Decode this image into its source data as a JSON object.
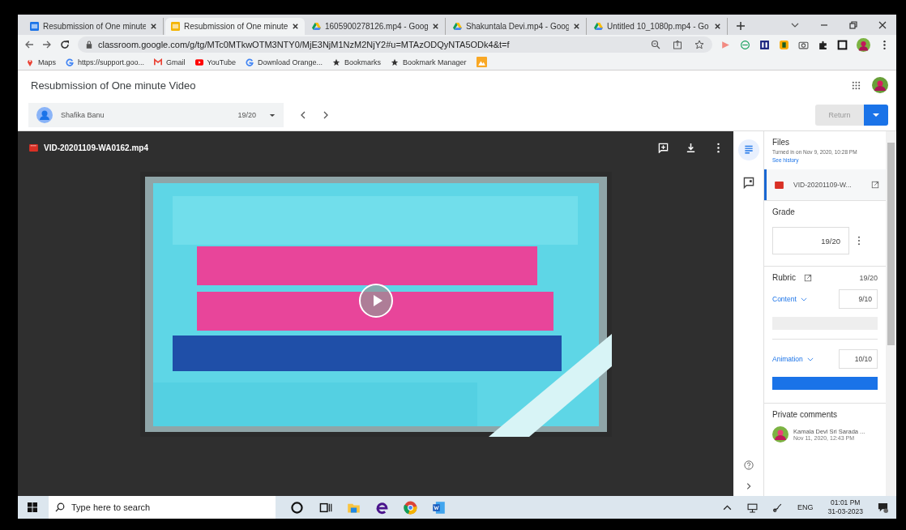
{
  "browser": {
    "tabs": [
      {
        "label": "Resubmission of One minute",
        "kind": "classroom",
        "selected": false
      },
      {
        "label": "Resubmission of One minute",
        "kind": "classroom",
        "selected": true
      },
      {
        "label": "1605900278126.mp4 - Goog",
        "kind": "drive",
        "selected": false
      },
      {
        "label": "Shakuntala Devi.mp4 - Goog",
        "kind": "drive",
        "selected": false
      },
      {
        "label": "Untitled 10_1080p.mp4 - Go",
        "kind": "drive",
        "selected": false
      }
    ],
    "address": "classroom.google.com/g/tg/MTc0MTkwOTM3NTY0/MjE3NjM1NzM2NjY2#u=MTAzODQyNTA5ODk4&t=f",
    "bookmarks": [
      {
        "label": "Maps",
        "kind": "pin"
      },
      {
        "label": "https://support.goo...",
        "kind": "g"
      },
      {
        "label": "Gmail",
        "kind": "gmail"
      },
      {
        "label": "YouTube",
        "kind": "youtube"
      },
      {
        "label": "Download Orange...",
        "kind": "g"
      },
      {
        "label": "Bookmarks",
        "kind": "star"
      },
      {
        "label": "Bookmark Manager",
        "kind": "star"
      }
    ]
  },
  "page": {
    "title": "Resubmission of One minute Video",
    "student": "Shafika Banu",
    "student_grade": "19/20",
    "return_button": {
      "label": "Return",
      "disabled": true
    }
  },
  "viewer": {
    "file_name": "VID-20201109-WA0162.mp4"
  },
  "sidebar": {
    "files_heading": "Files",
    "turned_in": "Turned in on Nov 9, 2020, 10:28 PM",
    "history_link": "See history",
    "attachment": "VID-20201109-W...",
    "grade_heading": "Grade",
    "grade": "19/20",
    "rubric_heading": "Rubric",
    "rubric_total": "19/20",
    "criteria": [
      {
        "name": "Content",
        "score": "9/10",
        "highlighted": false
      },
      {
        "name": "Animation",
        "score": "10/10",
        "highlighted": true
      }
    ],
    "comments_heading": "Private comments",
    "commenter": "Kamala Devi Sri Sarada ...",
    "comment_time": "Nov 11, 2020, 12:43 PM"
  },
  "taskbar": {
    "search_placeholder": "Type here to search",
    "language": "ENG",
    "time": "01:01 PM",
    "date": "31-03-2023"
  }
}
